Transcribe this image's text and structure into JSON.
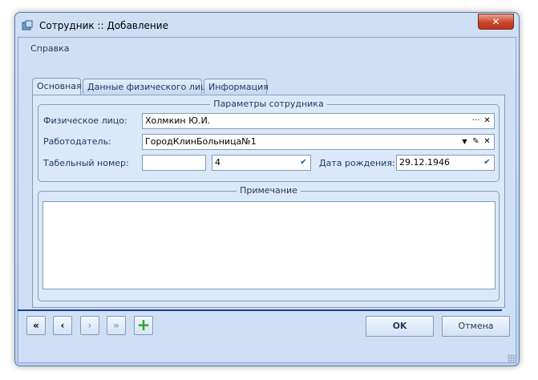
{
  "window": {
    "title": "Сотрудник :: Добавление",
    "close_label": "✕"
  },
  "menu": {
    "help": "Справка"
  },
  "tabs": [
    {
      "label": "Основная",
      "active": true
    },
    {
      "label": "Данные физического лица",
      "active": false
    },
    {
      "label": "Информация",
      "active": false
    }
  ],
  "params": {
    "title": "Параметры сотрудника",
    "person_label": "Физическое лицо:",
    "person_value": "Холмкин Ю.И.",
    "employer_label": "Работодатель:",
    "employer_value": "ГородКлинБольница№1",
    "tab_number_label": "Табельный номер:",
    "tab_number_value": "",
    "tab_number_select": "4",
    "birth_label": "Дата рождения:",
    "birth_value": "29.12.1946"
  },
  "note": {
    "title": "Примечание",
    "value": ""
  },
  "nav": {
    "first": "«",
    "prev": "‹",
    "next": "›",
    "last": "»",
    "add": "+"
  },
  "buttons": {
    "ok": "OK",
    "cancel": "Отмена"
  },
  "icons": {
    "ellipsis": "···",
    "clear": "✕",
    "dropdown": "▼",
    "edit": "✎",
    "check": "✔"
  }
}
